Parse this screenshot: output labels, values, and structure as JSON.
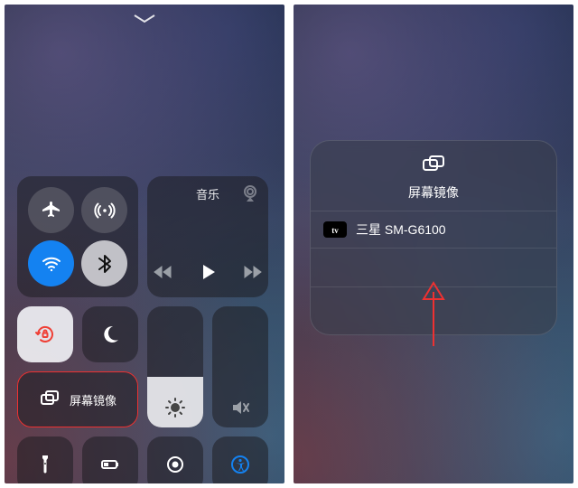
{
  "left": {
    "music_label": "音乐",
    "mirror_label": "屏幕镜像"
  },
  "right": {
    "panel_title": "屏幕镜像",
    "device_name": "三星 SM-G6100",
    "device_badge": "tv"
  }
}
